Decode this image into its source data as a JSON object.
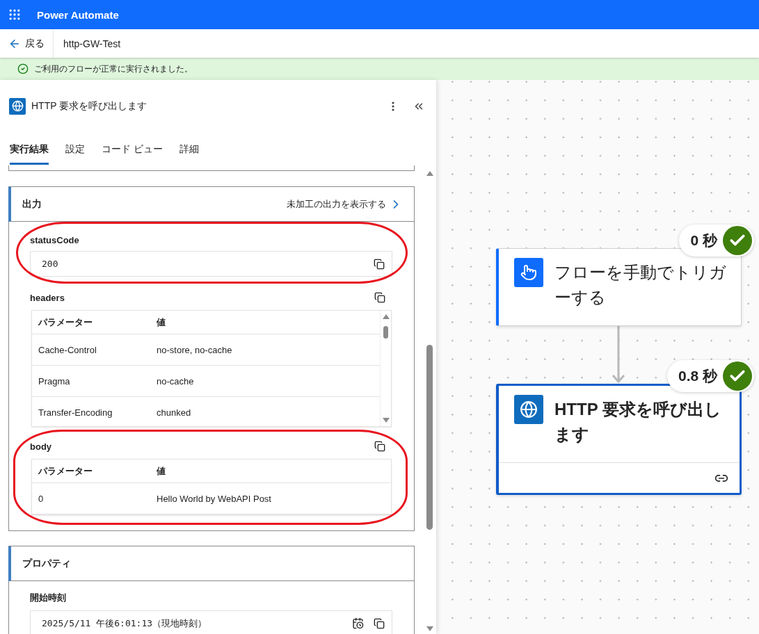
{
  "app": {
    "title": "Power Automate"
  },
  "nav": {
    "back": "戻る",
    "flow_name": "http-GW-Test"
  },
  "banner": {
    "message": "ご利用のフローが正常に実行されました。"
  },
  "panel": {
    "title": "HTTP 要求を呼び出します",
    "tabs": [
      {
        "label": "実行結果",
        "selected": true
      },
      {
        "label": "設定",
        "selected": false
      },
      {
        "label": "コード ビュー",
        "selected": false
      },
      {
        "label": "詳細",
        "selected": false
      }
    ],
    "output": {
      "title": "出力",
      "raw_link": "未加工の出力を表示する",
      "status_code": {
        "label": "statusCode",
        "value": "200"
      },
      "headers": {
        "label": "headers",
        "columns": [
          "パラメーター",
          "値"
        ],
        "rows": [
          [
            "Cache-Control",
            "no-store, no-cache"
          ],
          [
            "Pragma",
            "no-cache"
          ],
          [
            "Transfer-Encoding",
            "chunked"
          ]
        ]
      },
      "body": {
        "label": "body",
        "columns": [
          "パラメーター",
          "値"
        ],
        "rows": [
          [
            "0",
            "Hello World by WebAPI Post"
          ]
        ]
      }
    },
    "properties": {
      "title": "プロパティ",
      "start_time": {
        "label": "開始時刻",
        "value": "2025/5/11 午後6:01:13（現地時刻）"
      }
    }
  },
  "canvas": {
    "nodes": [
      {
        "kind": "trigger",
        "title": "フローを手動でトリガーする",
        "duration": "0 秒",
        "succeeded": true,
        "selected": false
      },
      {
        "kind": "http",
        "title": "HTTP 要求を呼び出します",
        "duration": "0.8 秒",
        "succeeded": true,
        "selected": true
      }
    ]
  }
}
